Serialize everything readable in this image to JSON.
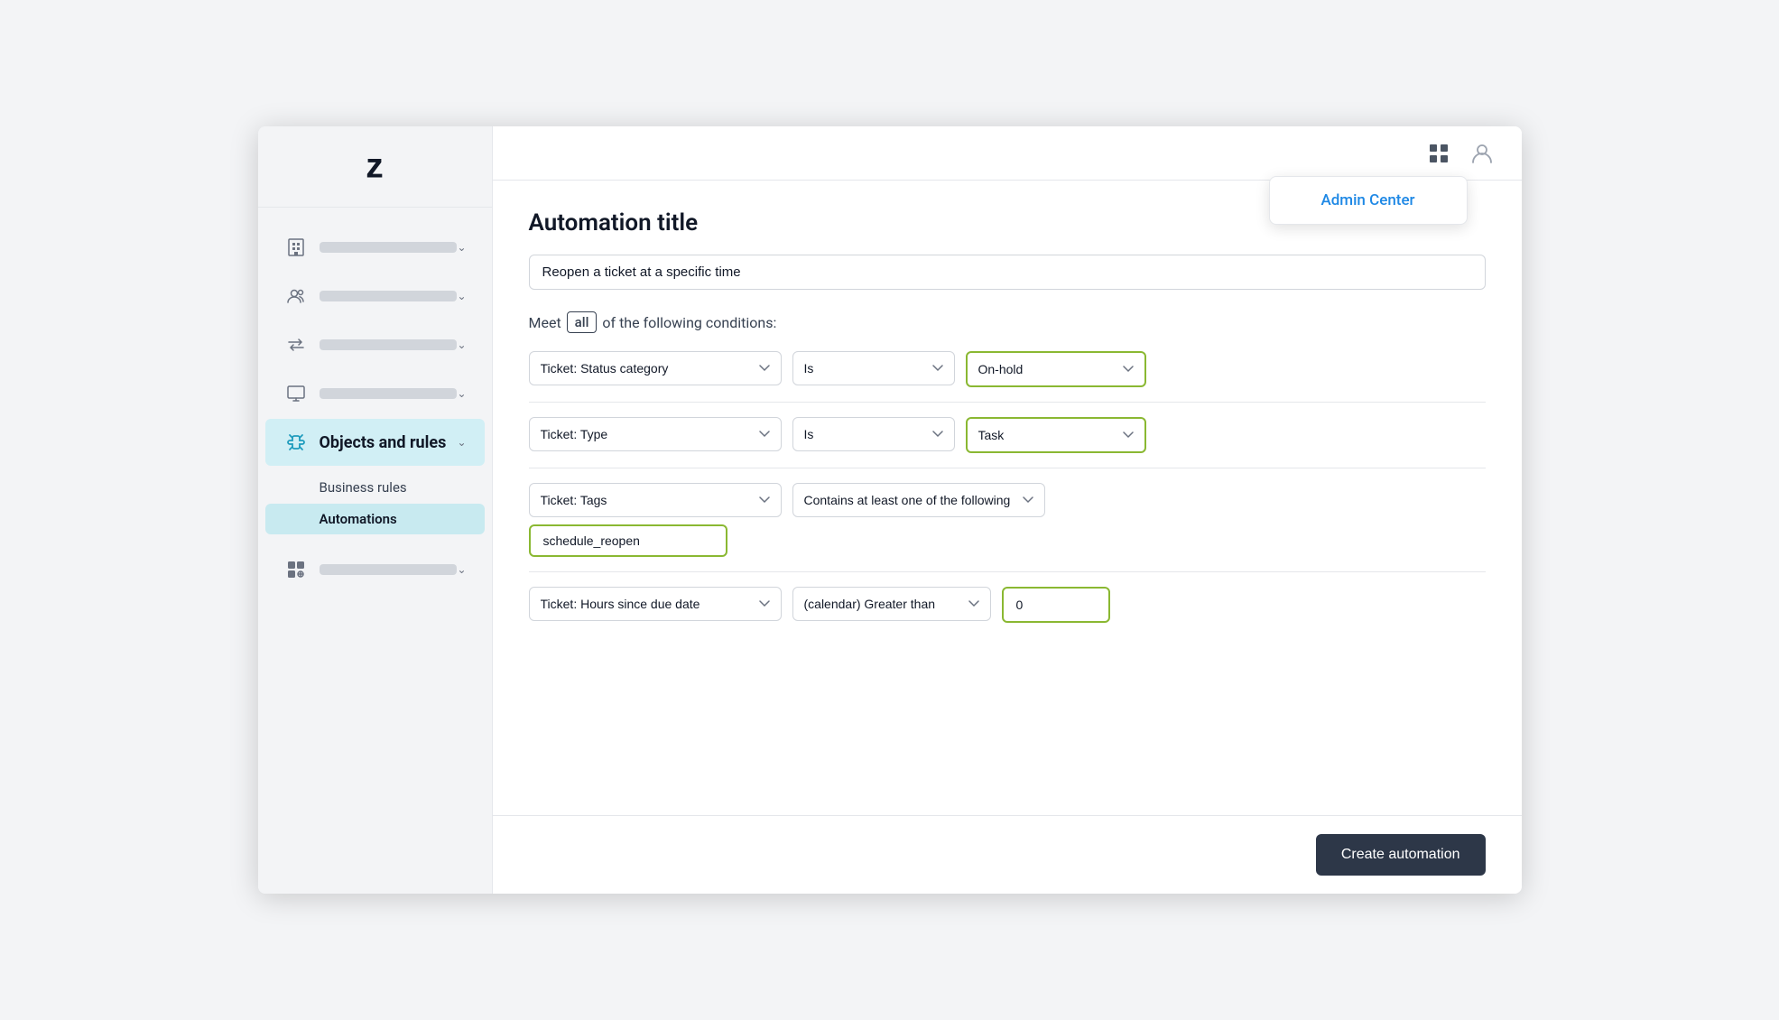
{
  "sidebar": {
    "nav_items": [
      {
        "id": "building",
        "icon": "building",
        "active": false
      },
      {
        "id": "users",
        "icon": "users",
        "active": false
      },
      {
        "id": "arrows",
        "icon": "arrows",
        "active": false
      },
      {
        "id": "monitor",
        "icon": "monitor",
        "active": false
      },
      {
        "id": "objects",
        "icon": "objects",
        "label": "Objects and rules",
        "active": true
      },
      {
        "id": "apps",
        "icon": "apps",
        "active": false
      }
    ],
    "sub_nav": [
      {
        "id": "business-rules",
        "label": "Business rules",
        "active": false
      },
      {
        "id": "automations",
        "label": "Automations",
        "active": true
      }
    ]
  },
  "topbar": {
    "admin_center_label": "Admin Center"
  },
  "page": {
    "title": "Automation title",
    "title_input_value": "Reopen a ticket at a specific time",
    "conditions_prefix": "Meet",
    "conditions_badge": "all",
    "conditions_suffix": "of the following conditions:",
    "conditions": [
      {
        "field": "Ticket: Status category",
        "operator": "Is",
        "value": "On-hold",
        "value_type": "select"
      },
      {
        "field": "Ticket: Type",
        "operator": "Is",
        "value": "Task",
        "value_type": "select"
      },
      {
        "field": "Ticket: Tags",
        "operator": "Contains at least one of the following",
        "value": "schedule_reopen",
        "value_type": "tag"
      },
      {
        "field": "Ticket: Hours since due date",
        "operator": "(calendar) Greater than",
        "value": "0",
        "value_type": "text"
      }
    ],
    "create_button_label": "Create automation"
  }
}
